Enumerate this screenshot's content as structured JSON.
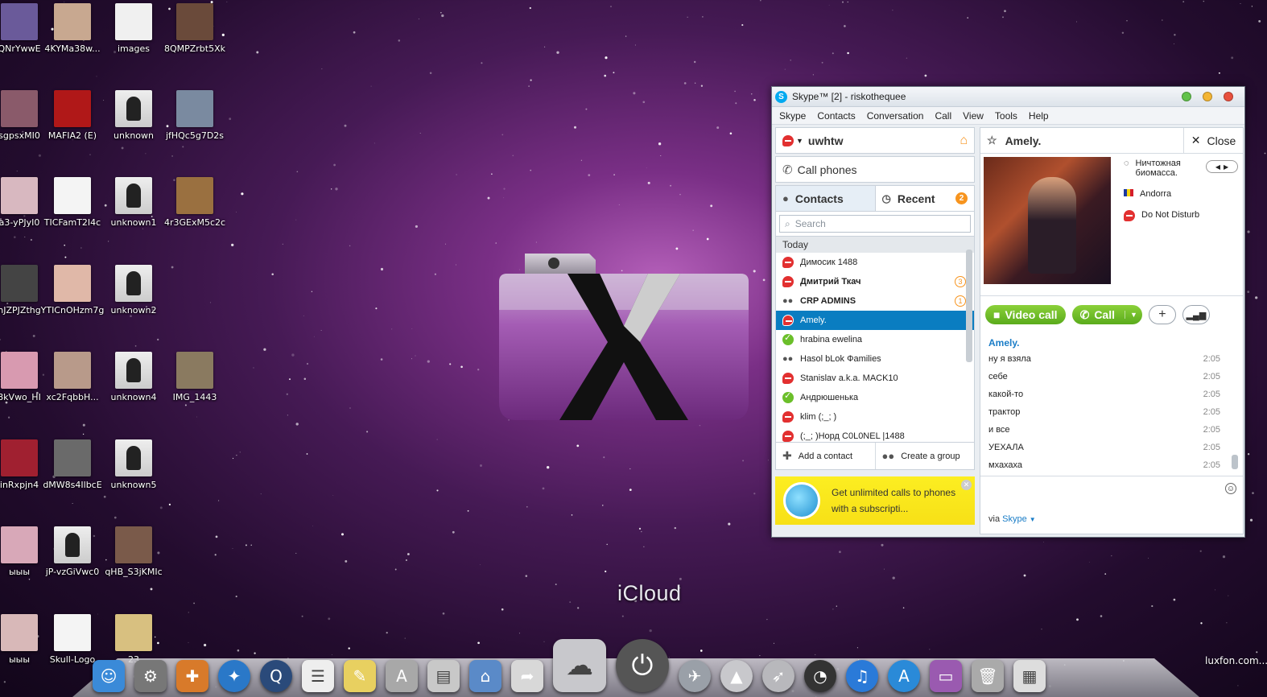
{
  "desktop": {
    "icons": [
      {
        "label": "QNrYwwE",
        "color": "#6a5a9a"
      },
      {
        "label": "4KYMa38w...",
        "color": "#c8a890"
      },
      {
        "label": "images",
        "color": "#f0f0f0"
      },
      {
        "label": "8QMPZrbt5Xk",
        "color": "#6a4a3a"
      },
      {
        "label": "sgpsxMI0",
        "color": "#8a5a6a"
      },
      {
        "label": "MAFIA2 (E)",
        "color": "#b01818"
      },
      {
        "label": "unknown",
        "color": "#ddd"
      },
      {
        "label": "jfHQc5g7D2s",
        "color": "#7a8aa0"
      },
      {
        "label": "a3-yPJyI0",
        "color": "#d8b8c0"
      },
      {
        "label": "TICFamT2I4c",
        "color": "#f4f4f4"
      },
      {
        "label": "unknown1",
        "color": "#ddd"
      },
      {
        "label": "4r3GExM5c2c",
        "color": "#9a7040"
      },
      {
        "label": "nJZPJZthg",
        "color": "#444"
      },
      {
        "label": "YTICnOHzm7g",
        "color": "#e0b8a8"
      },
      {
        "label": "unknown2",
        "color": "#ddd"
      },
      {
        "label": "8kVwo_HI",
        "color": "#d89ab0"
      },
      {
        "label": "xc2FqbbH...",
        "color": "#b89a8a"
      },
      {
        "label": "unknown4",
        "color": "#ddd"
      },
      {
        "label": "IMG_1443",
        "color": "#8a7a60"
      },
      {
        "label": "inRxpjn4",
        "color": "#a02030"
      },
      {
        "label": "dMW8s4IlbcE",
        "color": "#6a6a6a"
      },
      {
        "label": "unknown5",
        "color": "#ddd"
      },
      {
        "label": "ыыы",
        "color": "#d8a8b8"
      },
      {
        "label": "jP-vzGiVwc0",
        "color": "#ddd"
      },
      {
        "label": "qHB_S3jKMIc",
        "color": "#7a5a4a"
      },
      {
        "label": "ыыы",
        "color": "#d8b8b8"
      },
      {
        "label": "Skull-Logo",
        "color": "#f4f4f4"
      },
      {
        "label": "23",
        "color": "#d8c080"
      }
    ],
    "folder_caption": "iCloud",
    "watermark": "luxfon.com...",
    "dock_items": [
      {
        "name": "finder-icon",
        "glyph": "☺",
        "color": "#3a8ad8"
      },
      {
        "name": "system-preferences-icon",
        "glyph": "⚙",
        "color": "#777"
      },
      {
        "name": "launchpad-icon",
        "glyph": "✚",
        "color": "#d87a2a"
      },
      {
        "name": "safari-icon",
        "glyph": "✦",
        "color": "#2a78c8"
      },
      {
        "name": "quicktime-icon",
        "glyph": "Q",
        "color": "#2a4a7a"
      },
      {
        "name": "reminders-icon",
        "glyph": "☰",
        "color": "#eee"
      },
      {
        "name": "notes-icon",
        "glyph": "✎",
        "color": "#e8d060"
      },
      {
        "name": "app-installer-icon",
        "glyph": "A",
        "color": "#a8a8a8"
      },
      {
        "name": "archive-icon",
        "glyph": "▤",
        "color": "#c8c8c8"
      },
      {
        "name": "library-folder-icon",
        "glyph": "⌂",
        "color": "#5a8ac8"
      },
      {
        "name": "share-icon",
        "glyph": "➦",
        "color": "#d8d8d8"
      },
      {
        "name": "icloud-icon",
        "glyph": "☁",
        "color": "#c8c8cc"
      },
      {
        "name": "power-icon",
        "glyph": "⏻",
        "color": "#555"
      },
      {
        "name": "twitter-icon",
        "glyph": "✈",
        "color": "#9aa0a8"
      },
      {
        "name": "airplay-icon",
        "glyph": "▲",
        "color": "#c8c8cc"
      },
      {
        "name": "rocket-icon",
        "glyph": "➶",
        "color": "#b8b8bc"
      },
      {
        "name": "dashboard-icon",
        "glyph": "◔",
        "color": "#333"
      },
      {
        "name": "itunes-icon",
        "glyph": "♫",
        "color": "#2a7ad8"
      },
      {
        "name": "app-store-icon",
        "glyph": "A",
        "color": "#2a8ad8"
      },
      {
        "name": "desktop-icon",
        "glyph": "▭",
        "color": "#9a5ab0"
      },
      {
        "name": "trash-icon",
        "glyph": "🗑",
        "color": "#aaa"
      },
      {
        "name": "window-icon",
        "glyph": "▦",
        "color": "#ddd"
      }
    ]
  },
  "skype": {
    "title": "Skype™ [2] - riskothequee",
    "menu": [
      "Skype",
      "Contacts",
      "Conversation",
      "Call",
      "View",
      "Tools",
      "Help"
    ],
    "user": "uwhtw",
    "call_phones": "Call phones",
    "tab_contacts": "Contacts",
    "tab_recent": "Recent",
    "recent_badge": "2",
    "search_placeholder": "Search",
    "section": "Today",
    "contacts": [
      {
        "name": "Димосик 1488",
        "status": "red",
        "bold": false,
        "count": ""
      },
      {
        "name": "Дмитрий Ткач",
        "status": "red",
        "bold": true,
        "count": "3"
      },
      {
        "name": "CRP ADMINS",
        "status": "group",
        "bold": true,
        "count": "1"
      },
      {
        "name": "Amely.",
        "status": "red",
        "bold": false,
        "count": "",
        "selected": true
      },
      {
        "name": "hrabina ewelina",
        "status": "green",
        "bold": false,
        "count": ""
      },
      {
        "name": "Hasol bLok Фamilies",
        "status": "group",
        "bold": false,
        "count": ""
      },
      {
        "name": "Stanislav a.k.a.  MACK10",
        "status": "red",
        "bold": false,
        "count": ""
      },
      {
        "name": "Андрюшенька",
        "status": "green",
        "bold": false,
        "count": ""
      },
      {
        "name": "klim (;_; )",
        "status": "red",
        "bold": false,
        "count": ""
      },
      {
        "name": "(;_; )Норд C0L0NEL |1488",
        "status": "red",
        "bold": false,
        "count": ""
      }
    ],
    "add_contact": "Add a contact",
    "create_group": "Create a group",
    "promo_text": "Get unlimited calls to phones with a subscripti...",
    "conv_name": "Amely.",
    "close_label": "Close",
    "mood": "Ничтожная биомасса.",
    "country": "Andorra",
    "status_text": "Do Not Disturb",
    "video_call": "Video call",
    "call": "Call",
    "chat_sender": "Amely.",
    "messages": [
      {
        "text": "ну я взяла",
        "time": "2:05"
      },
      {
        "text": "себе",
        "time": "2:05"
      },
      {
        "text": "какой-то",
        "time": "2:05"
      },
      {
        "text": "трактор",
        "time": "2:05"
      },
      {
        "text": "и все",
        "time": "2:05"
      },
      {
        "text": "УЕХАЛА",
        "time": "2:05"
      },
      {
        "text": "мхахаха",
        "time": "2:05"
      }
    ],
    "via": "via",
    "via_link": "Skype"
  }
}
